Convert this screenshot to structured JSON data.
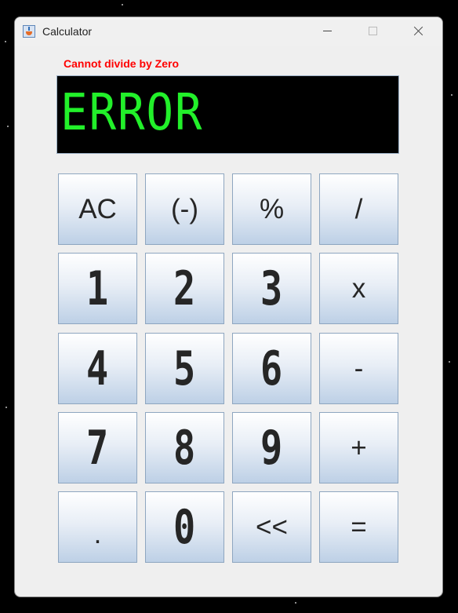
{
  "window": {
    "title": "Calculator"
  },
  "error_message": "Cannot divide by Zero",
  "display": {
    "value": "ERROR"
  },
  "keys": {
    "ac": "AC",
    "negate": "(-)",
    "percent": "%",
    "divide": "/",
    "one": "1",
    "two": "2",
    "three": "3",
    "multiply": "x",
    "four": "4",
    "five": "5",
    "six": "6",
    "subtract": "-",
    "seven": "7",
    "eight": "8",
    "nine": "9",
    "add": "+",
    "decimal": ".",
    "zero": "0",
    "backspace": "<<",
    "equals": "="
  },
  "colors": {
    "display_text": "#22f02a",
    "error_text": "#ff0000",
    "display_bg": "#000000"
  }
}
